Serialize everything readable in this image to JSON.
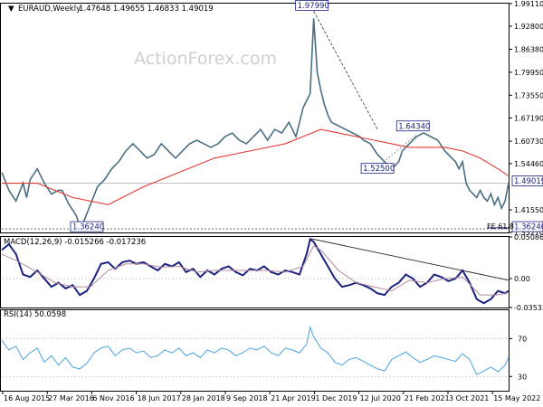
{
  "header": {
    "symbol_label": "EURAUD,Weekly",
    "ohlc": "1.47648 1.49655 1.46833 1.49019",
    "watermark": "ActionForex.com"
  },
  "chart_data": [
    {
      "type": "line",
      "panel": "price",
      "ylim": [
        1.3525,
        1.9911
      ],
      "y_ticks": [
        "1.99110",
        "1.92800",
        "1.86380",
        "1.79950",
        "1.73550",
        "1.67190",
        "1.60730",
        "1.54460",
        "1.41550",
        "1.35270"
      ],
      "y_tick_values": [
        1.9911,
        1.928,
        1.8638,
        1.7995,
        1.7355,
        1.6719,
        1.6073,
        1.5446,
        1.4155,
        1.3527
      ],
      "x_labels": [
        "16 Aug 2015",
        "27 Mar 2016",
        "6 Nov 2016",
        "18 Jun 2017",
        "28 Jan 2018",
        "9 Sep 2018",
        "21 Apr 2019",
        "1 Dec 2019",
        "12 Jul 2020",
        "21 Feb 2021",
        "3 Oct 2021",
        "15 May 2022"
      ],
      "series": [
        {
          "name": "",
          "color": "#4a6e82",
          "x": [
            0,
            4,
            8,
            12,
            14,
            16,
            20,
            24,
            28,
            32,
            34,
            38,
            42,
            44,
            46,
            50,
            54,
            58,
            62,
            66,
            70,
            74,
            78,
            82,
            86,
            90,
            94,
            98,
            102,
            106,
            110,
            114,
            118,
            122,
            126,
            130,
            134,
            138,
            142,
            146,
            150,
            154,
            158,
            162,
            166,
            170,
            174,
            176,
            178,
            180,
            182,
            184,
            186,
            190,
            194,
            198,
            202,
            204,
            208,
            212,
            216,
            220,
            224,
            226,
            230,
            234,
            238,
            242,
            246,
            250,
            254,
            256,
            258,
            260,
            262,
            264,
            266,
            268,
            270,
            272,
            274,
            276,
            278,
            280,
            282,
            284,
            286
          ],
          "y": [
            1.52,
            1.47,
            1.44,
            1.49,
            1.45,
            1.5,
            1.53,
            1.49,
            1.46,
            1.47,
            1.47,
            1.43,
            1.4,
            1.37,
            1.38,
            1.43,
            1.48,
            1.5,
            1.53,
            1.55,
            1.58,
            1.6,
            1.58,
            1.56,
            1.57,
            1.6,
            1.58,
            1.56,
            1.58,
            1.6,
            1.61,
            1.6,
            1.59,
            1.6,
            1.62,
            1.63,
            1.61,
            1.6,
            1.62,
            1.64,
            1.61,
            1.64,
            1.63,
            1.66,
            1.62,
            1.7,
            1.74,
            1.95,
            1.8,
            1.75,
            1.71,
            1.68,
            1.66,
            1.65,
            1.64,
            1.63,
            1.62,
            1.61,
            1.6,
            1.57,
            1.55,
            1.53,
            1.55,
            1.58,
            1.6,
            1.62,
            1.63,
            1.62,
            1.61,
            1.58,
            1.56,
            1.55,
            1.53,
            1.55,
            1.49,
            1.47,
            1.46,
            1.45,
            1.47,
            1.45,
            1.44,
            1.46,
            1.43,
            1.45,
            1.42,
            1.44,
            1.49
          ]
        },
        {
          "name": "",
          "color": "#e53935",
          "x": [
            0,
            20,
            40,
            60,
            80,
            100,
            120,
            140,
            160,
            170,
            180,
            190,
            200,
            210,
            220,
            230,
            240,
            250,
            260,
            270,
            280,
            286
          ],
          "y": [
            1.49,
            1.49,
            1.45,
            1.43,
            1.48,
            1.52,
            1.56,
            1.58,
            1.6,
            1.62,
            1.64,
            1.63,
            1.62,
            1.61,
            1.6,
            1.59,
            1.59,
            1.59,
            1.58,
            1.56,
            1.53,
            1.51
          ]
        }
      ],
      "annotations": [
        {
          "label": "1.97990",
          "x": 175,
          "y": 1.9799
        },
        {
          "label": "1.64340",
          "x": 232,
          "y": 1.6434
        },
        {
          "label": "1.52500",
          "x": 212,
          "y": 1.525
        },
        {
          "label": "1.36240",
          "x": 48,
          "y": 1.3624
        },
        {
          "label": "1.36240",
          "x": 282,
          "y": 1.3624
        },
        {
          "label": "1.49019",
          "x": 286,
          "y": 1.49019
        },
        {
          "label": "FE 61.8",
          "x": 276,
          "y": 1.37
        }
      ]
    },
    {
      "type": "line",
      "panel": "macd",
      "title": "MACD(12,26,9) -0.015266 -0.017236",
      "ylim": [
        -0.0353,
        0.0509
      ],
      "y_ticks": [
        "0.050863",
        "0.00",
        "-0.035322"
      ],
      "y_tick_values": [
        0.050863,
        0.0,
        -0.035322
      ],
      "series": [
        {
          "name": "",
          "color": "#1a237e",
          "x": [
            0,
            4,
            8,
            12,
            16,
            20,
            24,
            28,
            32,
            36,
            40,
            44,
            48,
            52,
            56,
            60,
            64,
            68,
            72,
            76,
            80,
            84,
            88,
            92,
            96,
            100,
            104,
            108,
            112,
            116,
            120,
            124,
            128,
            132,
            136,
            140,
            144,
            148,
            152,
            156,
            160,
            164,
            168,
            172,
            174,
            176,
            180,
            184,
            188,
            192,
            196,
            200,
            204,
            208,
            212,
            216,
            220,
            224,
            228,
            232,
            236,
            240,
            244,
            248,
            252,
            256,
            260,
            264,
            268,
            272,
            276,
            280,
            284,
            286
          ],
          "y": [
            0.035,
            0.042,
            0.03,
            0.005,
            0.002,
            0.01,
            0.0,
            -0.01,
            -0.005,
            -0.012,
            -0.008,
            -0.02,
            -0.015,
            0.0,
            0.018,
            0.02,
            0.012,
            0.02,
            0.022,
            0.018,
            0.02,
            0.015,
            0.01,
            0.018,
            0.015,
            0.02,
            0.008,
            0.012,
            0.002,
            0.01,
            0.005,
            0.012,
            0.015,
            0.008,
            0.004,
            0.012,
            0.01,
            0.015,
            0.008,
            0.005,
            0.01,
            0.008,
            0.005,
            0.03,
            0.048,
            0.045,
            0.03,
            0.015,
            0.0,
            -0.01,
            -0.008,
            -0.005,
            -0.008,
            -0.012,
            -0.018,
            -0.02,
            -0.01,
            -0.005,
            0.005,
            0.0,
            -0.01,
            -0.005,
            0.005,
            0.002,
            -0.003,
            0.0,
            0.01,
            -0.005,
            -0.025,
            -0.03,
            -0.025,
            -0.015,
            -0.018,
            -0.015
          ]
        },
        {
          "name": "",
          "color": "#b48aa0",
          "x": [
            0,
            10,
            20,
            30,
            40,
            50,
            60,
            70,
            80,
            90,
            100,
            110,
            120,
            130,
            140,
            150,
            160,
            170,
            176,
            180,
            190,
            200,
            210,
            220,
            230,
            240,
            250,
            260,
            270,
            280,
            286
          ],
          "y": [
            0.03,
            0.02,
            0.008,
            -0.005,
            -0.01,
            -0.01,
            0.01,
            0.018,
            0.018,
            0.014,
            0.015,
            0.008,
            0.01,
            0.01,
            0.01,
            0.01,
            0.008,
            0.015,
            0.04,
            0.035,
            0.01,
            -0.005,
            -0.01,
            -0.015,
            -0.002,
            -0.005,
            0.0,
            0.002,
            -0.02,
            -0.02,
            -0.017
          ]
        }
      ]
    },
    {
      "type": "line",
      "panel": "rsi",
      "title": "RSI(14) 50.0598",
      "ylim": [
        15,
        100
      ],
      "y_ticks": [
        "70",
        "30"
      ],
      "y_tick_values": [
        70,
        30
      ],
      "series": [
        {
          "name": "",
          "color": "#4aa3df",
          "x": [
            0,
            4,
            8,
            12,
            16,
            20,
            24,
            28,
            32,
            36,
            40,
            44,
            48,
            52,
            56,
            60,
            64,
            68,
            72,
            76,
            80,
            84,
            88,
            92,
            96,
            100,
            104,
            108,
            112,
            116,
            120,
            124,
            128,
            132,
            136,
            140,
            144,
            148,
            152,
            156,
            160,
            164,
            168,
            172,
            174,
            176,
            180,
            184,
            188,
            192,
            196,
            200,
            204,
            208,
            212,
            216,
            220,
            224,
            228,
            232,
            236,
            240,
            244,
            248,
            252,
            256,
            260,
            264,
            268,
            272,
            276,
            280,
            284,
            286
          ],
          "y": [
            68,
            58,
            62,
            48,
            55,
            60,
            45,
            52,
            42,
            50,
            40,
            38,
            44,
            55,
            60,
            62,
            52,
            58,
            60,
            55,
            57,
            50,
            52,
            58,
            55,
            60,
            52,
            55,
            50,
            58,
            55,
            60,
            58,
            52,
            55,
            60,
            58,
            62,
            55,
            52,
            60,
            58,
            55,
            64,
            82,
            72,
            60,
            55,
            45,
            42,
            48,
            50,
            46,
            42,
            38,
            36,
            48,
            52,
            56,
            50,
            45,
            48,
            52,
            50,
            48,
            46,
            54,
            48,
            32,
            36,
            40,
            35,
            42,
            50
          ]
        }
      ]
    }
  ]
}
